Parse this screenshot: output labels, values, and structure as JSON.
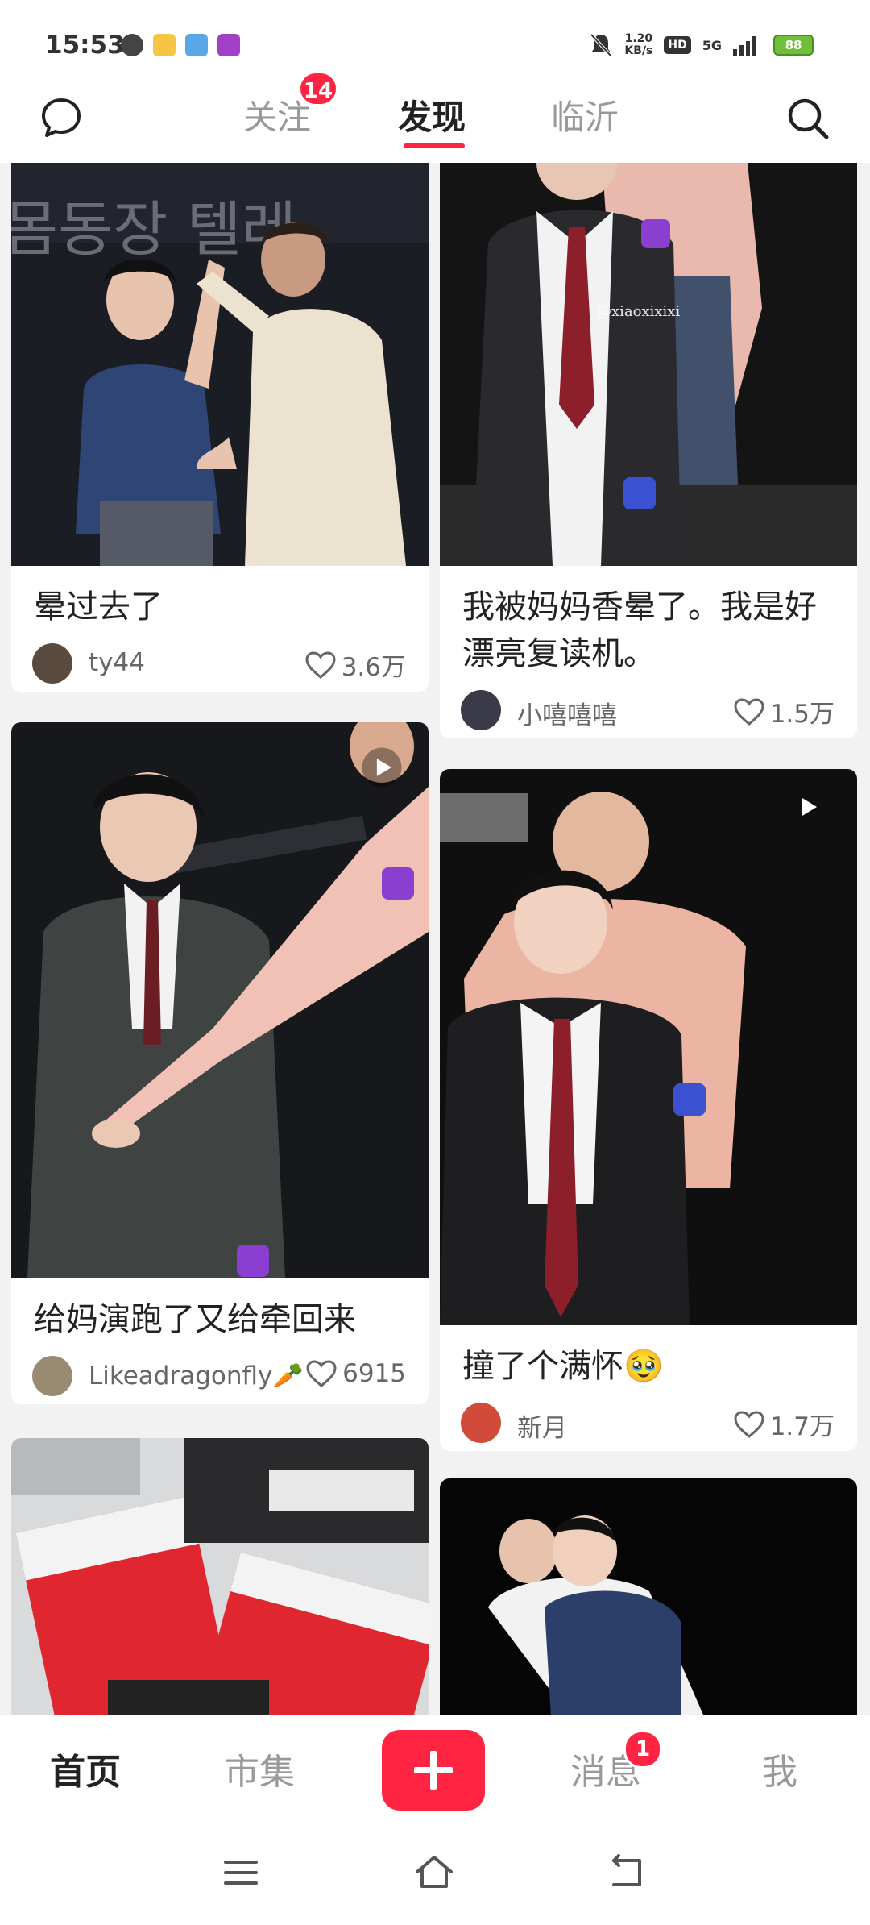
{
  "status_bar": {
    "time": "15:53",
    "speed_value": "1.20",
    "speed_unit": "KB/s",
    "hd": "HD",
    "network": "5G",
    "battery": "88"
  },
  "top_nav": {
    "tabs": [
      {
        "label": "关注",
        "badge": "14"
      },
      {
        "label": "发现"
      },
      {
        "label": "临沂"
      }
    ]
  },
  "feed": {
    "cards": [
      {
        "title": "晕过去了",
        "author": "ty44",
        "likes": "3.6万"
      },
      {
        "title": "我被妈妈香晕了。我是好漂亮复读机。",
        "author": "小嘻嘻嘻",
        "likes": "1.5万"
      },
      {
        "title": "给妈演跑了又给牵回来",
        "author": "Likeadragonfly🥕",
        "likes": "6915"
      },
      {
        "title": "撞了个满怀🥹",
        "author": "新月",
        "likes": "1.7万"
      },
      {
        "title": "",
        "author": "",
        "likes": ""
      },
      {
        "title": "",
        "author": "",
        "likes": ""
      }
    ],
    "image_watermark": "@xiaoxixixi",
    "image_caption_1": "몸동장 텔레"
  },
  "bottom_nav": {
    "items": [
      {
        "label": "首页"
      },
      {
        "label": "市集"
      },
      {
        "label": "消息",
        "badge": "1"
      },
      {
        "label": "我"
      }
    ]
  },
  "colors": {
    "accent": "#ff2442",
    "background": "#f2f2f2"
  }
}
